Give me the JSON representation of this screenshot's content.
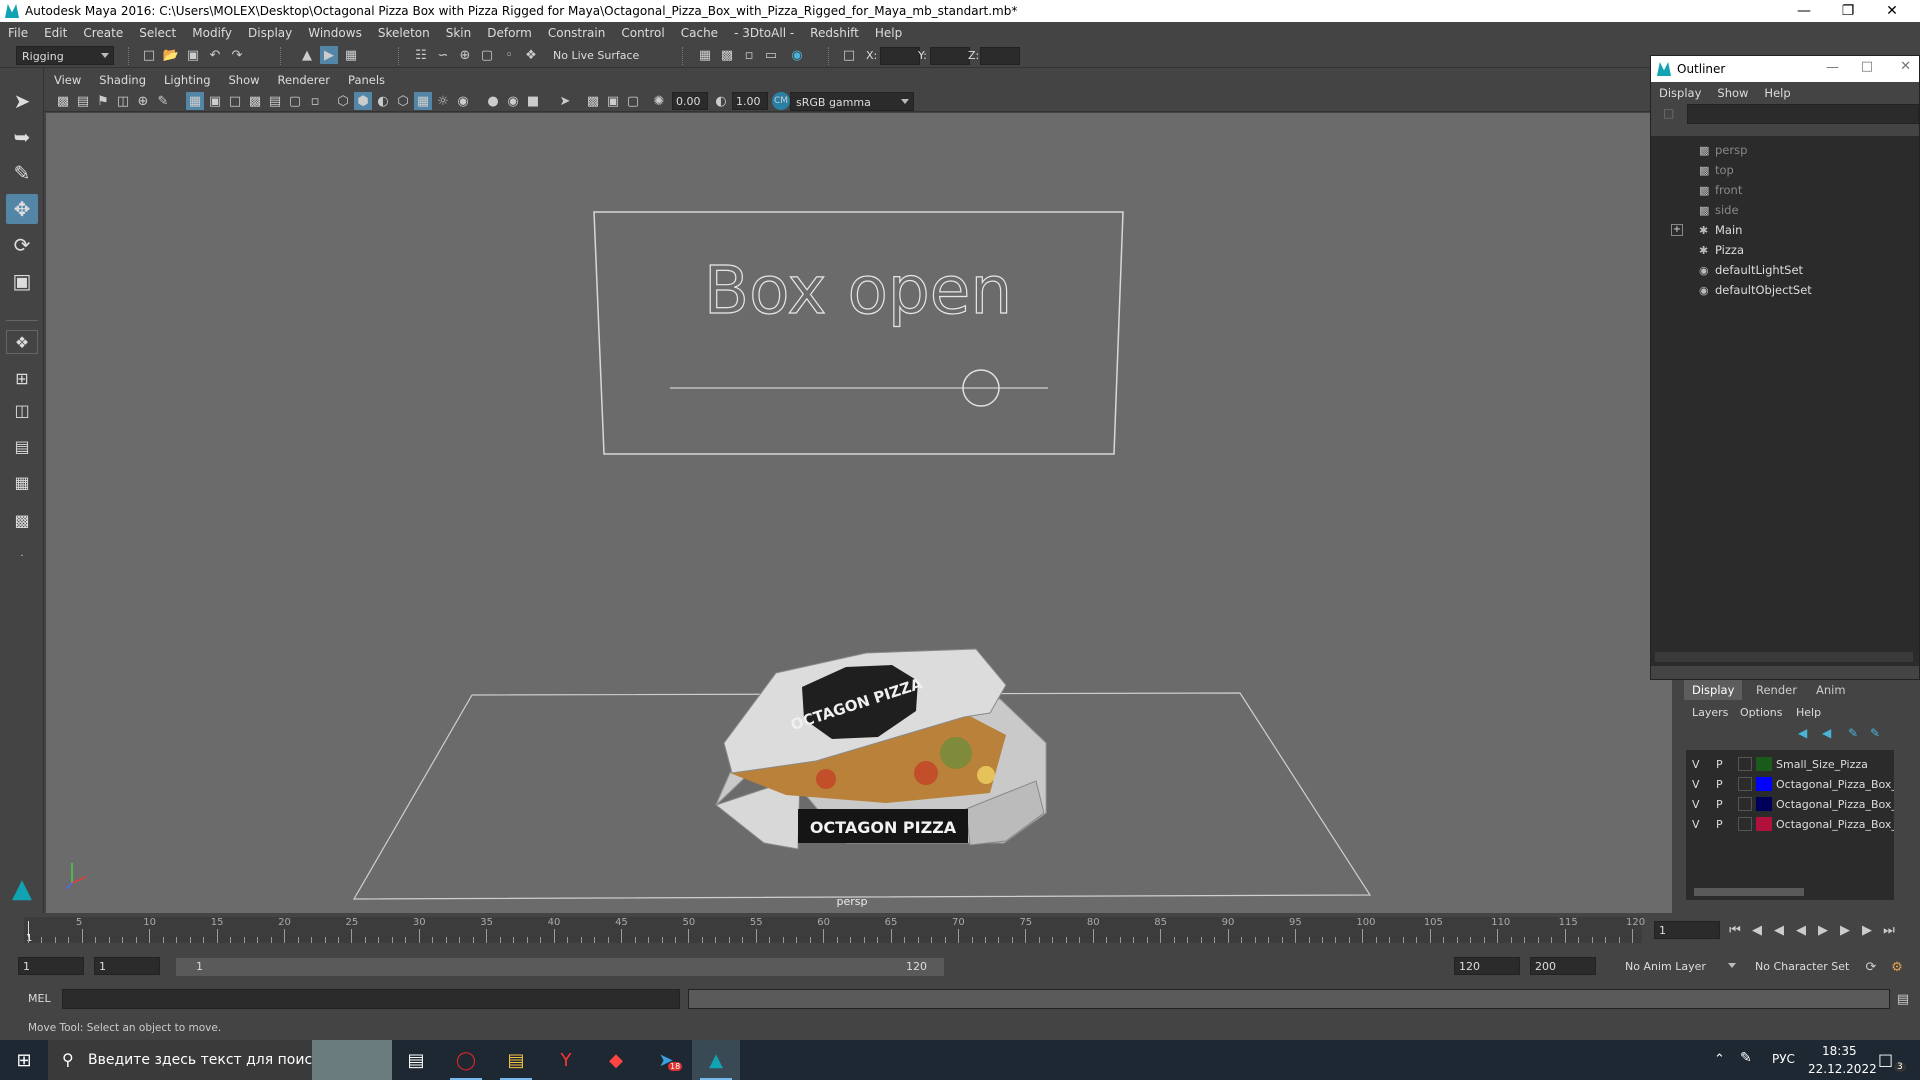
{
  "window": {
    "title": "Autodesk Maya 2016: C:\\Users\\MOLEX\\Desktop\\Octagonal Pizza Box with Pizza Rigged for Maya\\Octagonal_Pizza_Box_with_Pizza_Rigged_for_Maya_mb_standart.mb*"
  },
  "menu": [
    "File",
    "Edit",
    "Create",
    "Select",
    "Modify",
    "Display",
    "Windows",
    "Skeleton",
    "Skin",
    "Deform",
    "Constrain",
    "Control",
    "Cache",
    "- 3DtoAll -",
    "Redshift",
    "Help"
  ],
  "toolbar": {
    "menu_set": "Rigging",
    "live_surface": "No Live Surface",
    "x_label": "X:",
    "y_label": "Y:",
    "z_label": "Z:"
  },
  "panel_menu": [
    "View",
    "Shading",
    "Lighting",
    "Show",
    "Renderer",
    "Panels"
  ],
  "panel_toolbar": {
    "exposure": "0.00",
    "gamma": "1.00",
    "color_space": "sRGB gamma"
  },
  "viewport": {
    "control_label": "Box open",
    "box_top_text": "OCTAGON PIZZA",
    "box_front_text": "OCTAGON PIZZA",
    "camera": "persp"
  },
  "timeline": {
    "ticks": [
      "5",
      "10",
      "15",
      "20",
      "25",
      "30",
      "35",
      "40",
      "45",
      "50",
      "55",
      "60",
      "65",
      "70",
      "75",
      "80",
      "85",
      "90",
      "95",
      "100",
      "105",
      "110",
      "115",
      "120"
    ],
    "current_frame_marker": "1",
    "current_frame": "1"
  },
  "range": {
    "start": "1",
    "playback_start": "1",
    "slider_start": "1",
    "slider_end": "120",
    "playback_end": "120",
    "end": "200",
    "anim_layer": "No Anim Layer",
    "character_set": "No Character Set"
  },
  "command": {
    "label": "MEL"
  },
  "help_line": "Move Tool: Select an object to move.",
  "outliner": {
    "title": "Outliner",
    "menu": [
      "Display",
      "Show",
      "Help"
    ],
    "items": [
      {
        "label": "persp",
        "icon": "camera-icon",
        "dim": true
      },
      {
        "label": "top",
        "icon": "camera-icon",
        "dim": true
      },
      {
        "label": "front",
        "icon": "camera-icon",
        "dim": true
      },
      {
        "label": "side",
        "icon": "camera-icon",
        "dim": true
      },
      {
        "label": "Main",
        "icon": "group-icon",
        "dim": false
      },
      {
        "label": "Pizza",
        "icon": "group-icon",
        "dim": false
      },
      {
        "label": "defaultLightSet",
        "icon": "set-icon",
        "dim": false
      },
      {
        "label": "defaultObjectSet",
        "icon": "set-icon",
        "dim": false
      }
    ]
  },
  "layer_editor": {
    "tabs": [
      "Display",
      "Render",
      "Anim"
    ],
    "menu": [
      "Layers",
      "Options",
      "Help"
    ],
    "layers": [
      {
        "v": "V",
        "p": "P",
        "color": "#1a5a1a",
        "name": "Small_Size_Pizza"
      },
      {
        "v": "V",
        "p": "P",
        "color": "#0000ff",
        "name": "Octagonal_Pizza_Box_l"
      },
      {
        "v": "V",
        "p": "P",
        "color": "#00005a",
        "name": "Octagonal_Pizza_Box_v"
      },
      {
        "v": "V",
        "p": "P",
        "color": "#b0103a",
        "name": "Octagonal_Pizza_Box_c"
      }
    ]
  },
  "taskbar": {
    "search_placeholder": "Введите здесь текст для поиска",
    "language": "РУС",
    "time": "18:35",
    "date": "22.12.2022",
    "notifications": "3",
    "mail_badge": "18"
  }
}
